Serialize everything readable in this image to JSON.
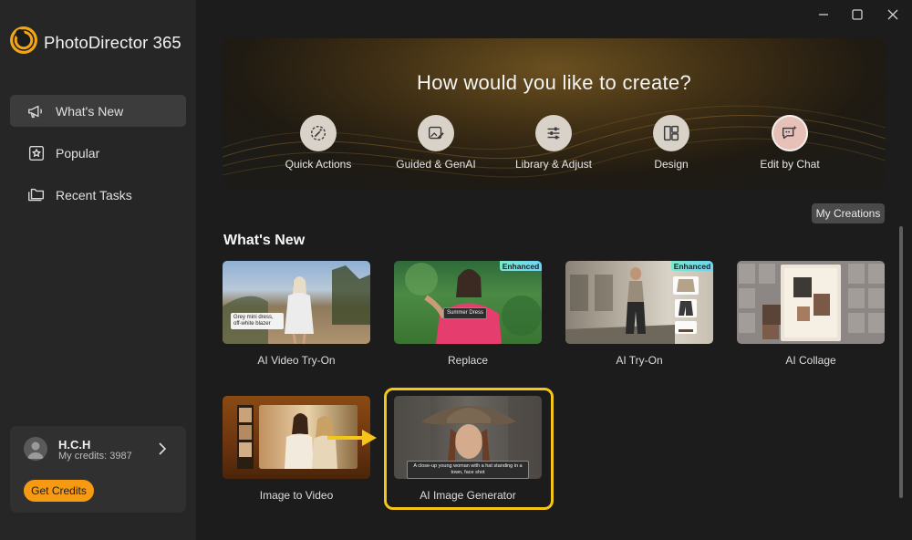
{
  "app": {
    "name": "PhotoDirector 365"
  },
  "sidebar": {
    "items": [
      {
        "label": "What's New",
        "icon": "megaphone-icon",
        "active": true
      },
      {
        "label": "Popular",
        "icon": "star-icon",
        "active": false
      },
      {
        "label": "Recent Tasks",
        "icon": "folders-icon",
        "active": false
      }
    ]
  },
  "user": {
    "name": "H.C.H",
    "credits": "My credits: 3987",
    "get_credits_label": "Get Credits"
  },
  "hero": {
    "title": "How would you like to create?",
    "options": [
      {
        "label": "Quick Actions",
        "icon": "magic-wand-icon"
      },
      {
        "label": "Guided & GenAI",
        "icon": "image-edit-icon"
      },
      {
        "label": "Library & Adjust",
        "icon": "sliders-icon"
      },
      {
        "label": "Design",
        "icon": "layout-icon"
      },
      {
        "label": "Edit by Chat",
        "icon": "chat-sparkle-icon"
      }
    ]
  },
  "my_creations_label": "My Creations",
  "section": {
    "title": "What's New",
    "cards": [
      {
        "label": "AI Video Try-On",
        "chip": "Grey mini dress, off-white blazer",
        "badge": ""
      },
      {
        "label": "Replace",
        "chip": "Summer Dress",
        "badge": "Enhanced"
      },
      {
        "label": "AI Try-On",
        "chip": "",
        "badge": "Enhanced"
      },
      {
        "label": "AI Collage",
        "chip": "",
        "badge": ""
      },
      {
        "label": "Image to Video",
        "chip": "",
        "badge": ""
      },
      {
        "label": "AI Image Generator",
        "chip": "A close-up young woman with a hat standing in a town, face shot",
        "badge": "",
        "highlighted": true
      }
    ]
  },
  "colors": {
    "accent": "#f59a12",
    "highlight": "#f5c518",
    "sidebar_bg": "#262626",
    "main_bg": "#1c1c1c"
  }
}
